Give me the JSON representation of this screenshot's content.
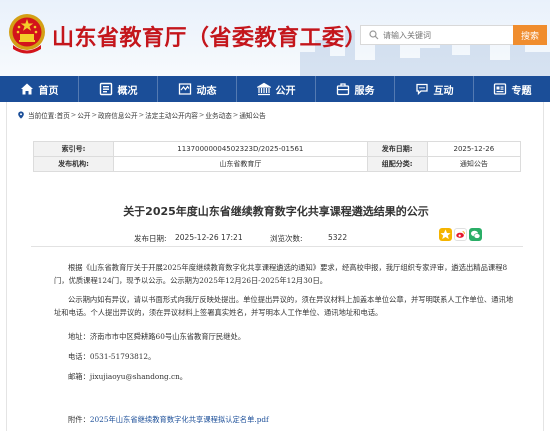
{
  "header": {
    "site_title": "山东省教育厅（省委教育工委）",
    "search_placeholder": "请输入关键词",
    "search_button": "搜索"
  },
  "nav": {
    "items": [
      {
        "label": "首页",
        "icon": "home-icon"
      },
      {
        "label": "概况",
        "icon": "overview-icon"
      },
      {
        "label": "动态",
        "icon": "news-icon"
      },
      {
        "label": "公开",
        "icon": "open-icon"
      },
      {
        "label": "服务",
        "icon": "service-icon"
      },
      {
        "label": "互动",
        "icon": "interaction-icon"
      },
      {
        "label": "专题",
        "icon": "topic-icon"
      }
    ]
  },
  "breadcrumb": {
    "prefix": "当前位置:",
    "items": [
      "首页",
      "公开",
      "政府信息公开",
      "法定主动公开内容",
      "业务动态",
      "通知公告"
    ]
  },
  "meta": {
    "index_label": "索引号:",
    "index_value": "11370000004502323D/2025-01561",
    "publish_date_label": "发布日期:",
    "publish_date_value": "2025-12-26",
    "org_label": "发布机构:",
    "org_value": "山东省教育厅",
    "category_label": "组配分类:",
    "category_value": "通知公告"
  },
  "article": {
    "title": "关于2025年度山东省继续教育数字化共享课程遴选结果的公示",
    "publish_date_label": "发布日期:",
    "publish_date_value": "2025-12-26 17:21",
    "view_count_label": "浏览次数:",
    "view_count_value": "5322",
    "p1": "根据《山东省教育厅关于开展2025年度继续教育数字化共享课程遴选的通知》要求，经高校申报，我厅组织专家评审，遴选出精品课程8门，优质课程124门，现予以公示。公示期为2025年12月26日-2025年12月30日。",
    "p2": "公示期内如有异议，请以书面形式向我厅反映处提出。单位提出异议的，须在异议材料上加盖本单位公章，并写明联系人工作单位、通讯地址和电话。个人提出异议的，须在异议材料上签署真实姓名，并写明本人工作单位、通讯地址和电话。",
    "address": "地址：济南市市中区舜耕路60号山东省教育厅民继处。",
    "phone": "电话：0531-51793812。",
    "email": "邮箱：jixujiaoyu@shandong.cn。",
    "attachment_label": "附件：",
    "attachment_link": "2025年山东省继续教育数字化共享课程拟认定名单.pdf"
  },
  "colors": {
    "brand_red": "#c4161c",
    "nav_blue": "#1b4e98",
    "search_orange": "#f08d2e"
  }
}
